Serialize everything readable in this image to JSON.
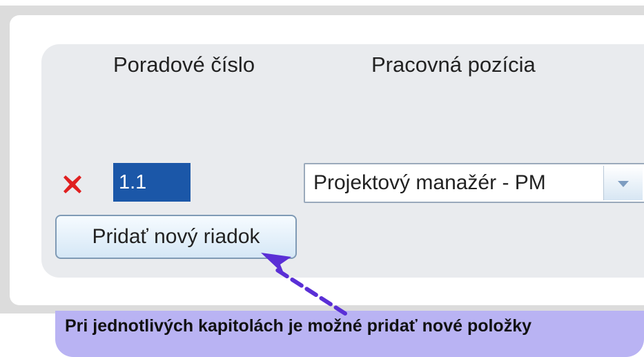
{
  "table": {
    "headers": {
      "order_number": "Poradové číslo",
      "work_position": "Pracovná pozícia"
    },
    "rows": [
      {
        "order_number": "1.1",
        "work_position": "Projektový manažér - PM"
      }
    ]
  },
  "actions": {
    "add_row_label": "Pridať nový riadok"
  },
  "callout": {
    "text": "Pri jednotlivých kapitolách je možné pridať nové položky"
  },
  "colors": {
    "input_highlight": "#1b57a8",
    "delete_icon": "#e02020",
    "callout_background": "#b9b3f3",
    "annotation_arrow": "#5a2fd6"
  },
  "icons": {
    "delete": "close-icon",
    "dropdown": "chevron-down-icon",
    "annotation": "arrow-icon"
  }
}
